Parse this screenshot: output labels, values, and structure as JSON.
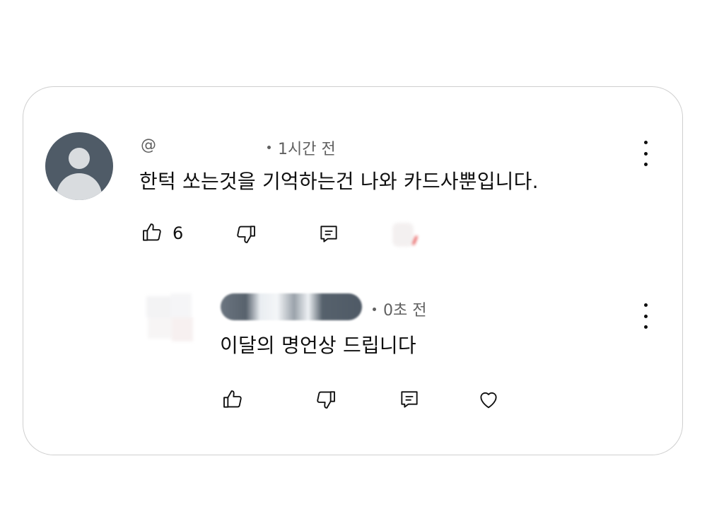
{
  "comment": {
    "handle": "@",
    "time": "1시간 전",
    "text": "한턱 쏘는것을 기억하는건 나와 카드사뿐입니다.",
    "like_count": "6",
    "icons": {
      "avatar": "default-avatar-icon",
      "like": "thumb-up-icon",
      "dislike": "thumb-down-icon",
      "reply": "reply-icon",
      "more": "more-vertical-icon"
    }
  },
  "reply": {
    "time": "0초 전",
    "text": "이달의 명언상 드립니다",
    "icons": {
      "like": "thumb-up-icon",
      "dislike": "thumb-down-icon",
      "reply": "reply-icon",
      "heart": "heart-icon",
      "more": "more-vertical-icon"
    }
  },
  "colors": {
    "card_border": "#cfcfcf",
    "avatar_bg": "#4f5b67",
    "avatar_fg": "#d9dcdf",
    "text_primary": "#0f0f0f",
    "text_secondary": "#606060"
  }
}
